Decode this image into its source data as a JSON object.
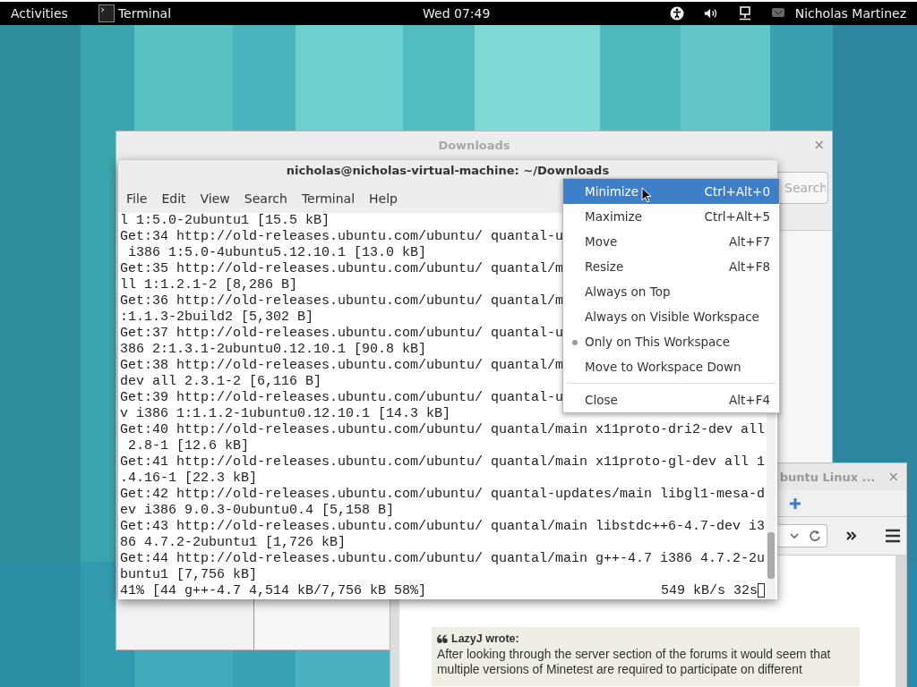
{
  "top_bar": {
    "activities": "Activities",
    "app": "Terminal",
    "clock": "Wed 07:49",
    "user": "Nicholas Martinez"
  },
  "file_manager": {
    "title": "Downloads",
    "close": "×",
    "search": {
      "placeholder": "Search"
    }
  },
  "browser": {
    "title": "buntu Linux ...",
    "close": "×",
    "quote": {
      "author": "LazyJ wrote:",
      "lines": [
        "After looking through the server section of the forums it would seem that",
        "multiple versions of Minetest are required to participate on different"
      ]
    }
  },
  "terminal": {
    "title": "nicholas@nicholas-virtual-machine: ~/Downloads",
    "menu": [
      "File",
      "Edit",
      "View",
      "Search",
      "Terminal",
      "Help"
    ],
    "lines": [
      "l 1:5.0-2ubuntu1 [15.5 kB]",
      "Get:34 http://old-releases.ubuntu.com/ubuntu/ quantal-u",
      " i386 1:5.0-4ubuntu5.12.10.1 [13.0 kB]",
      "Get:35 http://old-releases.ubuntu.com/ubuntu/ quantal/m",
      "ll 1:1.2.1-2 [8,286 B]",
      "Get:36 http://old-releases.ubuntu.com/ubuntu/ quantal/m",
      ":1.1.3-2build2 [5,302 B]",
      "Get:37 http://old-releases.ubuntu.com/ubuntu/ quantal-u",
      "386 2:1.3.1-2ubuntu0.12.10.1 [90.8 kB]",
      "Get:38 http://old-releases.ubuntu.com/ubuntu/ quantal/m",
      "dev all 2.3.1-2 [6,116 B]",
      "Get:39 http://old-releases.ubuntu.com/ubuntu/ quantal-u",
      "v i386 1:1.1.2-1ubuntu0.12.10.1 [14.3 kB]",
      "Get:40 http://old-releases.ubuntu.com/ubuntu/ quantal/main x11proto-dri2-dev all",
      " 2.8-1 [12.6 kB]",
      "Get:41 http://old-releases.ubuntu.com/ubuntu/ quantal/main x11proto-gl-dev all 1",
      ".4.16-1 [22.3 kB]",
      "Get:42 http://old-releases.ubuntu.com/ubuntu/ quantal-updates/main libgl1-mesa-d",
      "ev i386 9.0.3-0ubuntu0.4 [5,158 B]",
      "Get:43 http://old-releases.ubuntu.com/ubuntu/ quantal/main libstdc++6-4.7-dev i3",
      "86 4.7.2-2ubuntu1 [1,726 kB]",
      "Get:44 http://old-releases.ubuntu.com/ubuntu/ quantal/main g++-4.7 i386 4.7.2-2u",
      "buntu1 [7,756 kB]"
    ],
    "status": {
      "progress": "41% [44 g++-4.7 4,514 kB/7,756 kB 58%]",
      "rate": "549 kB/s 32s"
    }
  },
  "window_menu": {
    "items": [
      {
        "kind": "item",
        "label": "Minimize",
        "shortcut": "Ctrl+Alt+0",
        "selected": true,
        "checked": false
      },
      {
        "kind": "item",
        "label": "Maximize",
        "shortcut": "Ctrl+Alt+5",
        "selected": false,
        "checked": false
      },
      {
        "kind": "item",
        "label": "Move",
        "shortcut": "Alt+F7",
        "selected": false,
        "checked": false
      },
      {
        "kind": "item",
        "label": "Resize",
        "shortcut": "Alt+F8",
        "selected": false,
        "checked": false
      },
      {
        "kind": "item",
        "label": "Always on Top",
        "selected": false,
        "checked": false
      },
      {
        "kind": "item",
        "label": "Always on Visible Workspace",
        "selected": false,
        "checked": false
      },
      {
        "kind": "item",
        "label": "Only on This Workspace",
        "selected": false,
        "checked": true
      },
      {
        "kind": "item",
        "label": "Move to Workspace Down",
        "selected": false,
        "checked": false
      },
      {
        "kind": "separator"
      },
      {
        "kind": "item",
        "label": "Close",
        "shortcut": "Alt+F4",
        "selected": false,
        "checked": false
      }
    ]
  }
}
